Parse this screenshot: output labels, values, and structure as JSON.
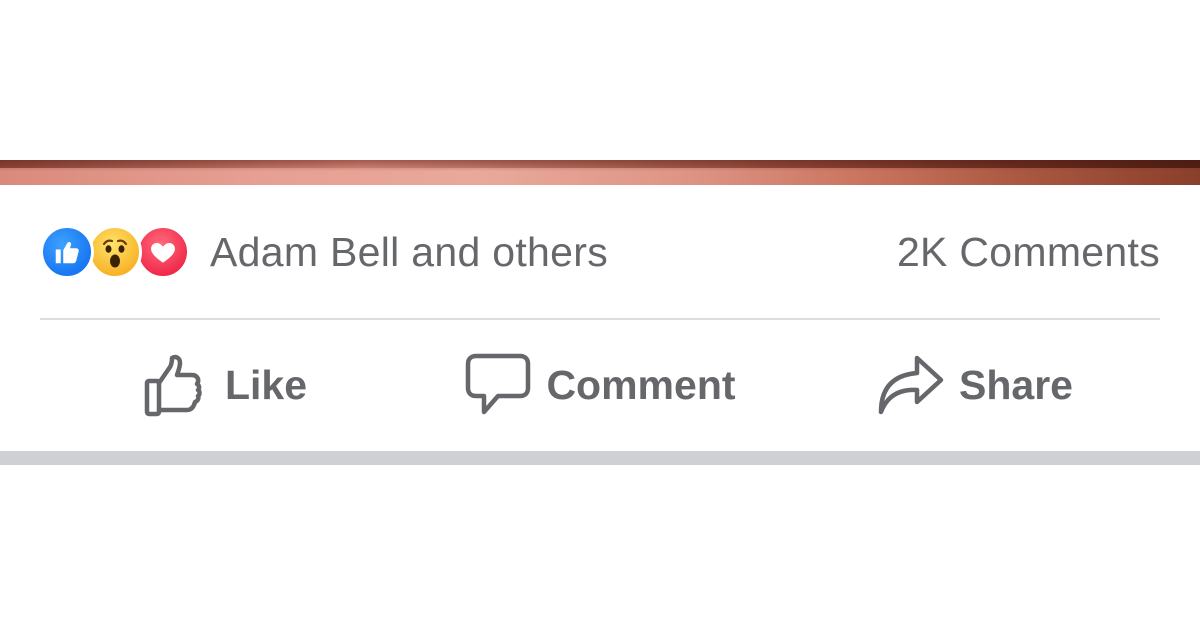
{
  "post": {
    "reactions": {
      "icons": [
        "like-icon",
        "wow-icon",
        "love-icon"
      ],
      "summary_text": "Adam Bell and others",
      "comments_text": "2K Comments"
    },
    "actions": {
      "like_label": "Like",
      "comment_label": "Comment",
      "share_label": "Share"
    }
  },
  "colors": {
    "text_secondary": "#65676b",
    "like_blue": "#1877f2",
    "wow_yellow": "#f7b125",
    "love_red": "#f02849",
    "divider": "#dadde1",
    "bottom_bar": "#ced0d4"
  }
}
